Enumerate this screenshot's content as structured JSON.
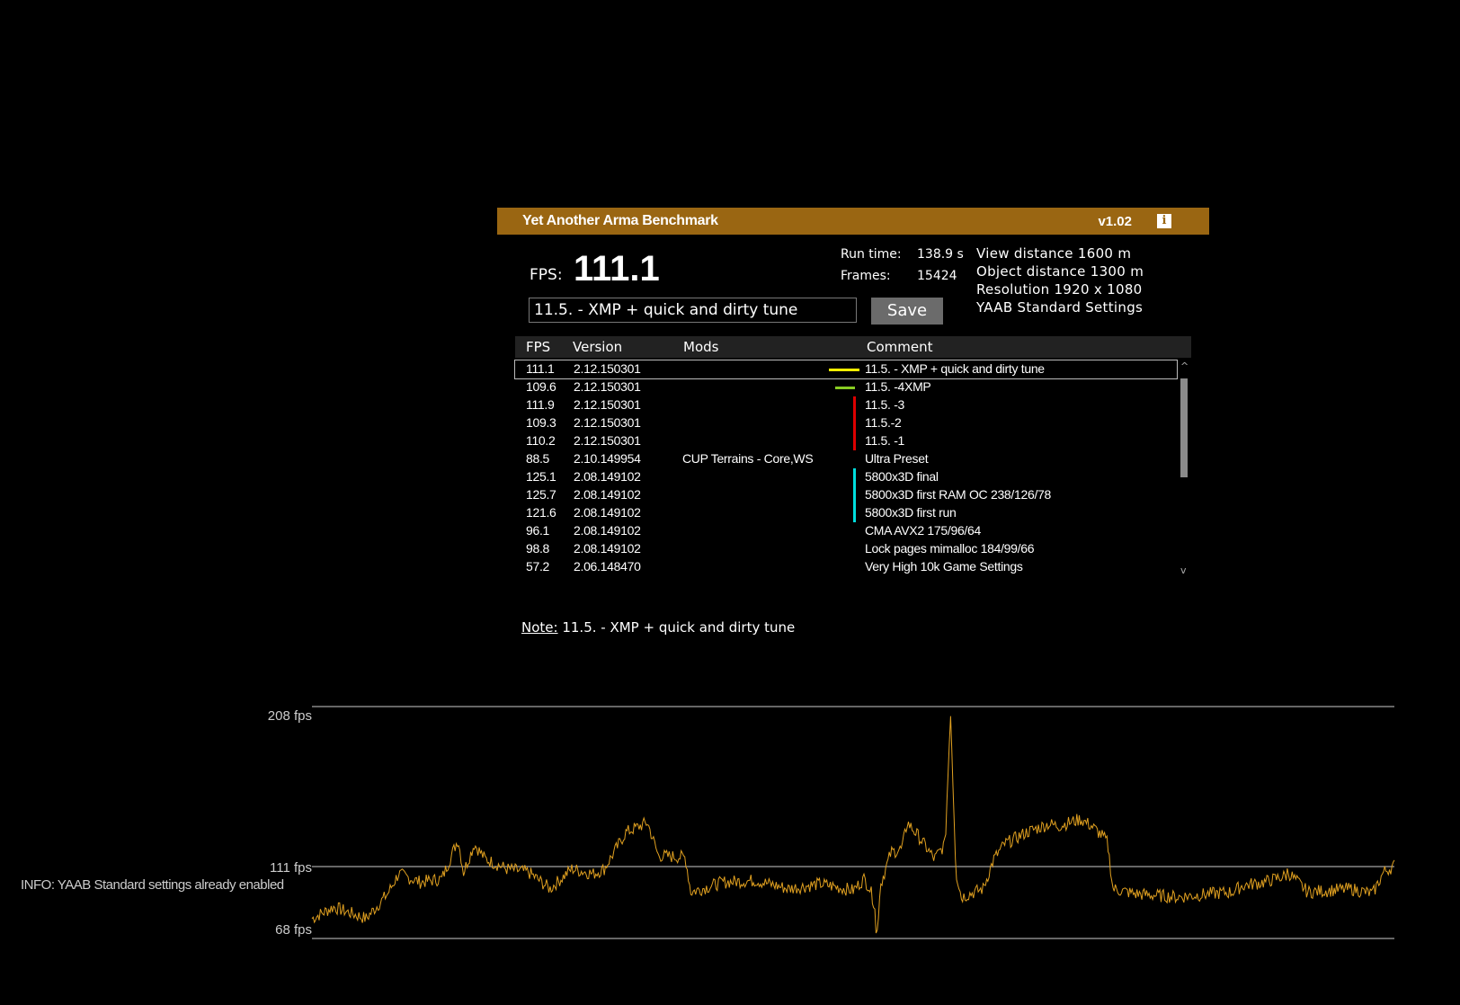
{
  "app": {
    "title": "Yet Another Arma Benchmark",
    "version": "v1.02",
    "accent_color": "#9a6612",
    "info_icon": "info-icon"
  },
  "result": {
    "fps_label": "FPS:",
    "fps_value": "111.1",
    "runtime_label": "Run time:",
    "runtime_value": "138.9 s",
    "frames_label": "Frames:",
    "frames_value": "15424"
  },
  "settings": [
    "View distance 1600 m",
    "Object distance 1300 m",
    "Resolution 1920 x 1080",
    "YAAB Standard Settings"
  ],
  "comment_input": {
    "value": "11.5. - XMP + quick and dirty tune"
  },
  "save_label": "Save",
  "table": {
    "headers": [
      "FPS",
      "Version",
      "Mods",
      "Comment"
    ],
    "rows": [
      {
        "fps": "111.1",
        "version": "2.12.150301",
        "mods": "",
        "comment": "11.5. - XMP + quick and dirty tune",
        "marker": "#ffee00",
        "marker_type": "dash"
      },
      {
        "fps": "109.6",
        "version": "2.12.150301",
        "mods": "",
        "comment": "11.5. -4XMP",
        "marker": "#88cc22",
        "marker_type": "dash-short"
      },
      {
        "fps": "111.9",
        "version": "2.12.150301",
        "mods": "",
        "comment": "11.5. -3",
        "marker": "#dd0000",
        "marker_type": "bar"
      },
      {
        "fps": "109.3",
        "version": "2.12.150301",
        "mods": "",
        "comment": "11.5.-2",
        "marker": "#dd0000",
        "marker_type": "bar"
      },
      {
        "fps": "110.2",
        "version": "2.12.150301",
        "mods": "",
        "comment": "11.5. -1",
        "marker": "#dd0000",
        "marker_type": "bar"
      },
      {
        "fps": "88.5",
        "version": "2.10.149954",
        "mods": "CUP Terrains - Core,WS",
        "comment": "Ultra Preset",
        "marker": "",
        "marker_type": ""
      },
      {
        "fps": "125.1",
        "version": "2.08.149102",
        "mods": "",
        "comment": "5800x3D final",
        "marker": "#00dddd",
        "marker_type": "bar"
      },
      {
        "fps": "125.7",
        "version": "2.08.149102",
        "mods": "",
        "comment": "5800x3D first RAM OC 238/126/78",
        "marker": "#00dddd",
        "marker_type": "bar"
      },
      {
        "fps": "121.6",
        "version": "2.08.149102",
        "mods": "",
        "comment": "5800x3D first run",
        "marker": "#00dddd",
        "marker_type": "bar"
      },
      {
        "fps": "96.1",
        "version": "2.08.149102",
        "mods": "",
        "comment": "CMA AVX2 175/96/64",
        "marker": "",
        "marker_type": ""
      },
      {
        "fps": "98.8",
        "version": "2.08.149102",
        "mods": "",
        "comment": "Lock pages mimalloc 184/99/66",
        "marker": "",
        "marker_type": ""
      },
      {
        "fps": "57.2",
        "version": "2.06.148470",
        "mods": "",
        "comment": "Very High 10k Game Settings",
        "marker": "",
        "marker_type": ""
      }
    ]
  },
  "note": {
    "label": "Note:",
    "text": "11.5. - XMP + quick and dirty tune"
  },
  "graph": {
    "max_label": "208 fps",
    "avg_label": "111 fps",
    "min_label": "68 fps",
    "line_color": "#e0a020",
    "max": 208,
    "avg": 111,
    "min": 68
  },
  "info_message": "INFO: YAAB Standard settings already enabled"
}
